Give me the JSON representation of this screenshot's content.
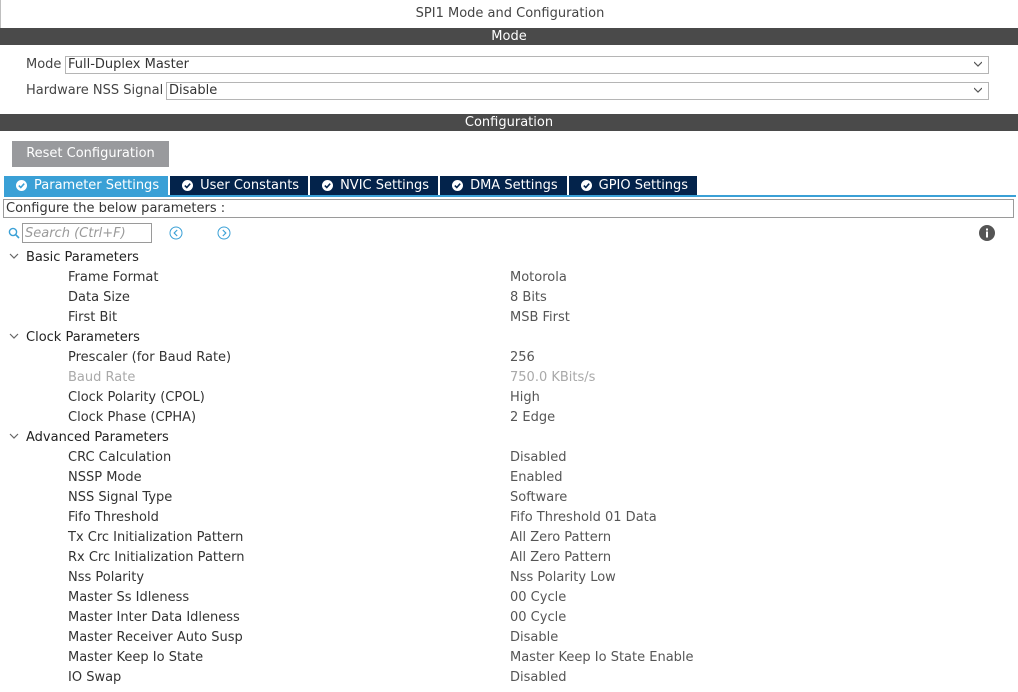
{
  "window_title": "SPI1 Mode and Configuration",
  "mode_section": {
    "header": "Mode",
    "mode_label": "Mode",
    "mode_value": "Full-Duplex Master",
    "nss_label": "Hardware NSS Signal",
    "nss_value": "Disable"
  },
  "config_section": {
    "header": "Configuration",
    "reset_button": "Reset Configuration",
    "tabs": [
      {
        "label": "Parameter Settings",
        "active": true
      },
      {
        "label": "User Constants",
        "active": false
      },
      {
        "label": "NVIC Settings",
        "active": false
      },
      {
        "label": "DMA Settings",
        "active": false
      },
      {
        "label": "GPIO Settings",
        "active": false
      }
    ],
    "description": "Configure the below parameters :",
    "search_placeholder": "Search (Ctrl+F)"
  },
  "groups": [
    {
      "label": "Basic Parameters",
      "params": [
        {
          "name": "Frame Format",
          "value": "Motorola"
        },
        {
          "name": "Data Size",
          "value": "8 Bits"
        },
        {
          "name": "First Bit",
          "value": "MSB First"
        }
      ]
    },
    {
      "label": "Clock Parameters",
      "params": [
        {
          "name": "Prescaler (for Baud Rate)",
          "value": "256"
        },
        {
          "name": "Baud Rate",
          "value": "750.0 KBits/s",
          "disabled": true
        },
        {
          "name": "Clock Polarity (CPOL)",
          "value": "High"
        },
        {
          "name": "Clock Phase (CPHA)",
          "value": "2 Edge"
        }
      ]
    },
    {
      "label": "Advanced Parameters",
      "params": [
        {
          "name": "CRC Calculation",
          "value": "Disabled"
        },
        {
          "name": "NSSP Mode",
          "value": "Enabled"
        },
        {
          "name": "NSS Signal Type",
          "value": "Software"
        },
        {
          "name": "Fifo Threshold",
          "value": "Fifo Threshold 01 Data"
        },
        {
          "name": "Tx Crc Initialization Pattern",
          "value": "All Zero Pattern"
        },
        {
          "name": "Rx Crc Initialization Pattern",
          "value": "All Zero Pattern"
        },
        {
          "name": "Nss Polarity",
          "value": "Nss Polarity Low"
        },
        {
          "name": "Master Ss Idleness",
          "value": "00 Cycle"
        },
        {
          "name": "Master Inter Data Idleness",
          "value": "00 Cycle"
        },
        {
          "name": "Master Receiver Auto Susp",
          "value": "Disable"
        },
        {
          "name": "Master Keep Io State",
          "value": "Master Keep Io State Enable"
        },
        {
          "name": "IO Swap",
          "value": "Disabled"
        }
      ]
    }
  ],
  "icons": {
    "dropdown": "chevron-down-icon",
    "tab_status": "check-circle-icon",
    "search": "search-icon",
    "prev": "arrow-left-circle-icon",
    "next": "arrow-right-circle-icon",
    "info": "info-icon",
    "group_toggle": "chevron-down-icon"
  },
  "colors": {
    "section_bar": "#4a4a4a",
    "tab_active": "#3aa0d6",
    "tab_inactive": "#03234b",
    "reset_button": "#999a9d",
    "disabled_text": "#a9a9a9"
  }
}
